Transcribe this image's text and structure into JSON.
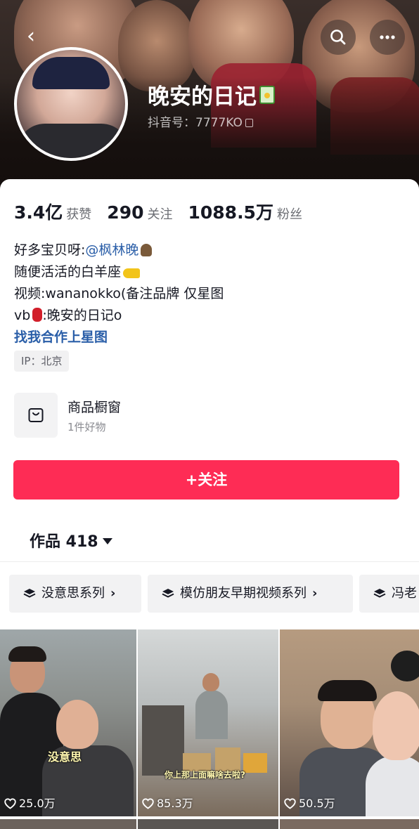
{
  "header": {
    "back_glyph": "‹",
    "nickname": "晚安的日记",
    "douyin_id": "抖音号：7777KO"
  },
  "stats": [
    {
      "num": "3.4亿",
      "label": "获赞"
    },
    {
      "num": "290",
      "label": "关注"
    },
    {
      "num": "1088.5万",
      "label": "粉丝"
    }
  ],
  "bio": {
    "line1_prefix": "好多宝贝呀:",
    "line1_mention": "@枫林晚",
    "line2": "随便活活的白羊座",
    "line3": "视频:wananokko(备注品牌 仅星图",
    "line4_prefix": "vb",
    "line4_suffix": ":晚安的日记o",
    "link": "找我合作上星图"
  },
  "ip_tag": "IP：北京",
  "shop": {
    "title": "商品橱窗",
    "subtitle": "1件好物"
  },
  "follow_button": "+关注",
  "works_tab": "作品 418",
  "series": [
    {
      "label": "没意思系列"
    },
    {
      "label": "模仿朋友早期视频系列"
    },
    {
      "label": "冯老"
    }
  ],
  "videos": [
    {
      "likes": "25.0万",
      "caption": "没意思"
    },
    {
      "likes": "85.3万",
      "caption": "你上那上面嘛啥去啦?"
    },
    {
      "likes": "50.5万",
      "caption": ""
    }
  ],
  "colors": {
    "accent": "#fe2c55",
    "mention": "#2a5ea8"
  }
}
